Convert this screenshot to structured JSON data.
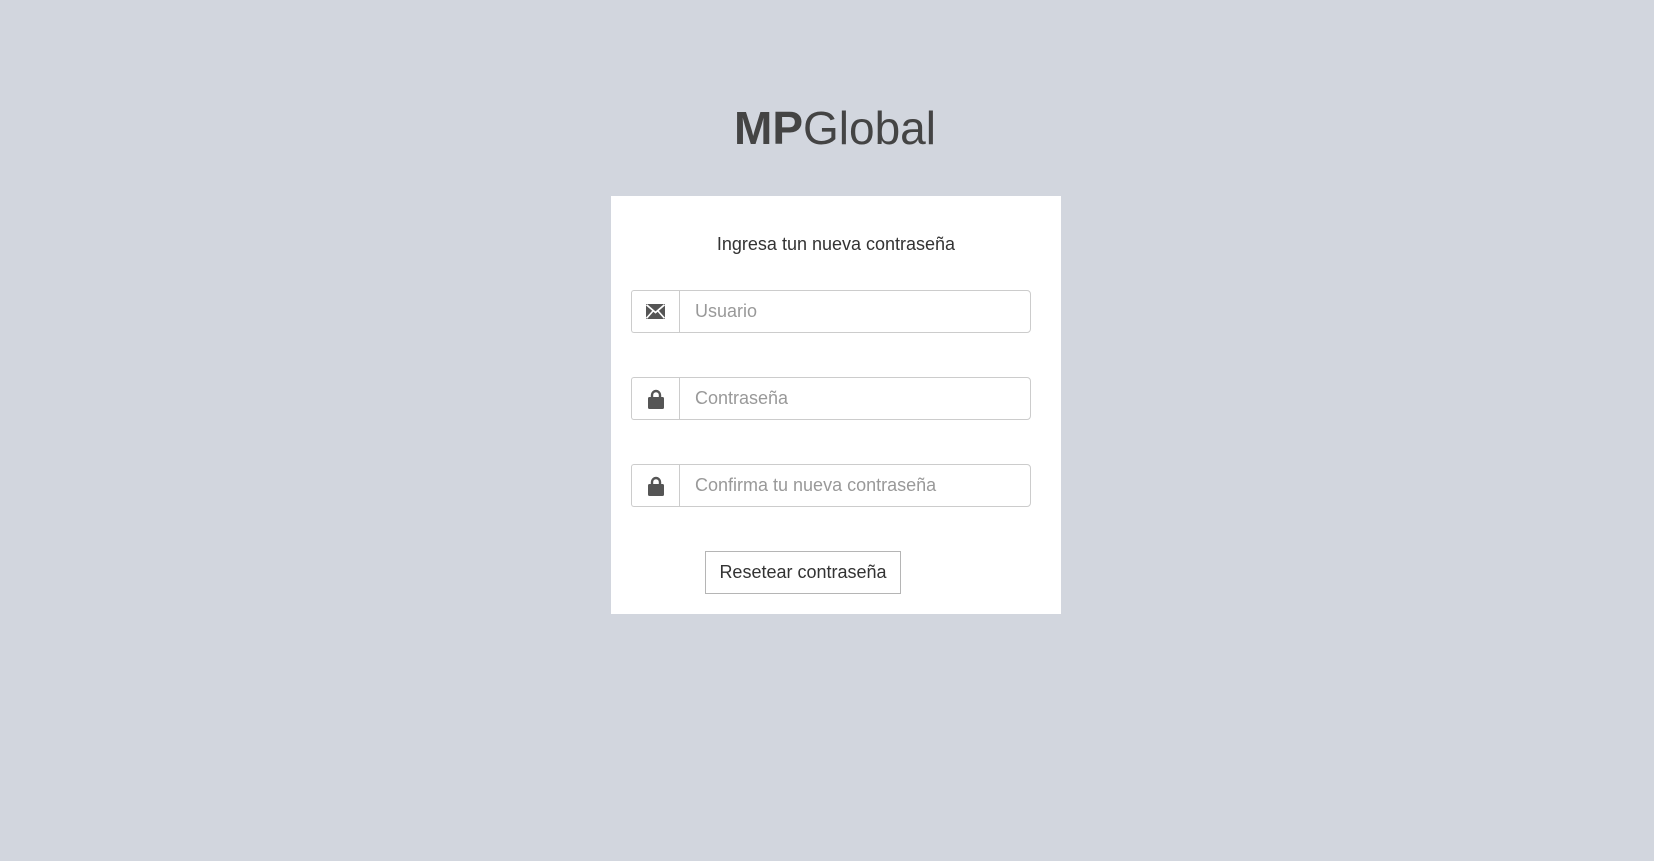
{
  "logo": {
    "bold": "MP",
    "regular": "Global"
  },
  "form": {
    "message": "Ingresa tun nueva contraseña",
    "user_placeholder": "Usuario",
    "password_placeholder": "Contraseña",
    "confirm_placeholder": "Confirma tu nueva contraseña",
    "submit_label": "Resetear contraseña"
  },
  "icons": {
    "user_field": "envelope-icon",
    "password_field": "lock-icon",
    "confirm_field": "lock-icon"
  },
  "colors": {
    "background": "#d2d6de",
    "box": "#ffffff",
    "icon": "#555555",
    "logo_text": "#444444"
  }
}
